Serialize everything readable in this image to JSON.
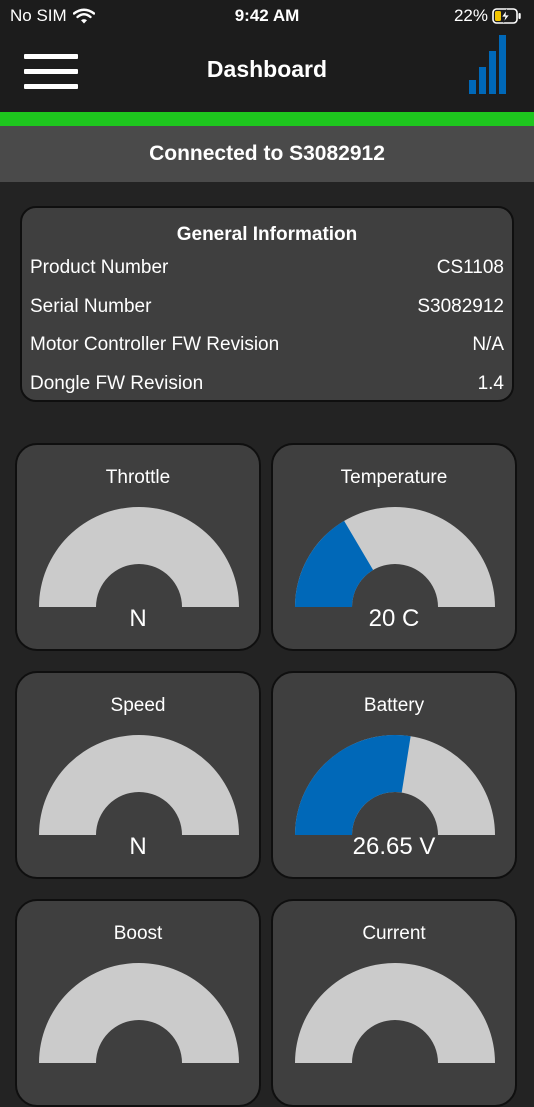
{
  "status_bar": {
    "carrier": "No SIM",
    "time": "9:42 AM",
    "battery_percent": "22%"
  },
  "nav": {
    "title": "Dashboard"
  },
  "connection": {
    "text": "Connected to S3082912",
    "status_color": "#1ec61e"
  },
  "general_info": {
    "title": "General Information",
    "rows": [
      {
        "label": "Product Number",
        "value": "CS1108"
      },
      {
        "label": "Serial Number",
        "value": "S3082912"
      },
      {
        "label": "Motor Controller FW Revision",
        "value": "N/A"
      },
      {
        "label": "Dongle FW Revision",
        "value": "1.4"
      }
    ]
  },
  "gauges": [
    {
      "title": "Throttle",
      "value": "N",
      "fill": 0
    },
    {
      "title": "Temperature",
      "value": "20 C",
      "fill": 0.33
    },
    {
      "title": "Speed",
      "value": "N",
      "fill": 0
    },
    {
      "title": "Battery",
      "value": "26.65 V",
      "fill": 0.55
    },
    {
      "title": "Boost",
      "value": "",
      "fill": 0
    },
    {
      "title": "Current",
      "value": "",
      "fill": 0
    }
  ],
  "colors": {
    "accent": "#0068b8",
    "gauge_track": "#cbcbcb",
    "card_bg": "#3f3f3f"
  }
}
